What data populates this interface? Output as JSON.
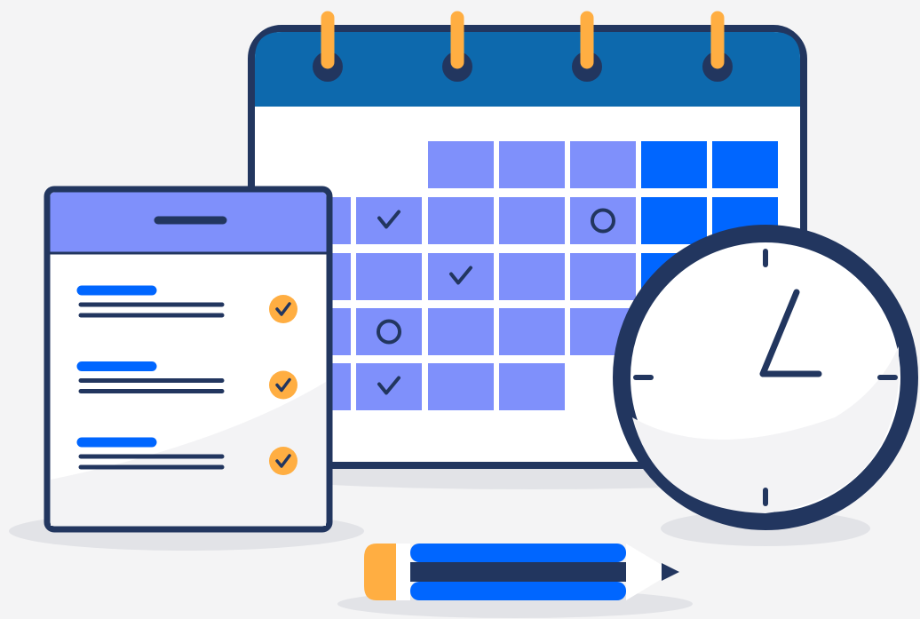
{
  "illustration": {
    "subject": "calendar-checklist-clock-pencil",
    "calendar": {
      "ring_count": 4,
      "marks": [
        {
          "row": 1,
          "col": 1,
          "icon": "check-icon"
        },
        {
          "row": 1,
          "col": 4,
          "icon": "circle-icon"
        },
        {
          "row": 2,
          "col": 2,
          "icon": "check-icon"
        },
        {
          "row": 3,
          "col": 1,
          "icon": "circle-icon"
        },
        {
          "row": 4,
          "col": 1,
          "icon": "check-icon"
        }
      ]
    },
    "checklist": {
      "items": [
        {
          "checked": true
        },
        {
          "checked": true
        },
        {
          "checked": true
        }
      ]
    },
    "clock": {
      "hour": 1,
      "minute": 15
    }
  },
  "colors": {
    "background": "#f4f4f5",
    "shadow": "#e2e3e7",
    "navy": "#22365f",
    "calendar_header": "#0d69ad",
    "cell_light": "#7f90fb",
    "cell_dark": "#0066ff",
    "orange": "#ffae42",
    "white": "#ffffff",
    "accent_blue": "#0066ff",
    "checklist_header": "#7f90fb"
  }
}
